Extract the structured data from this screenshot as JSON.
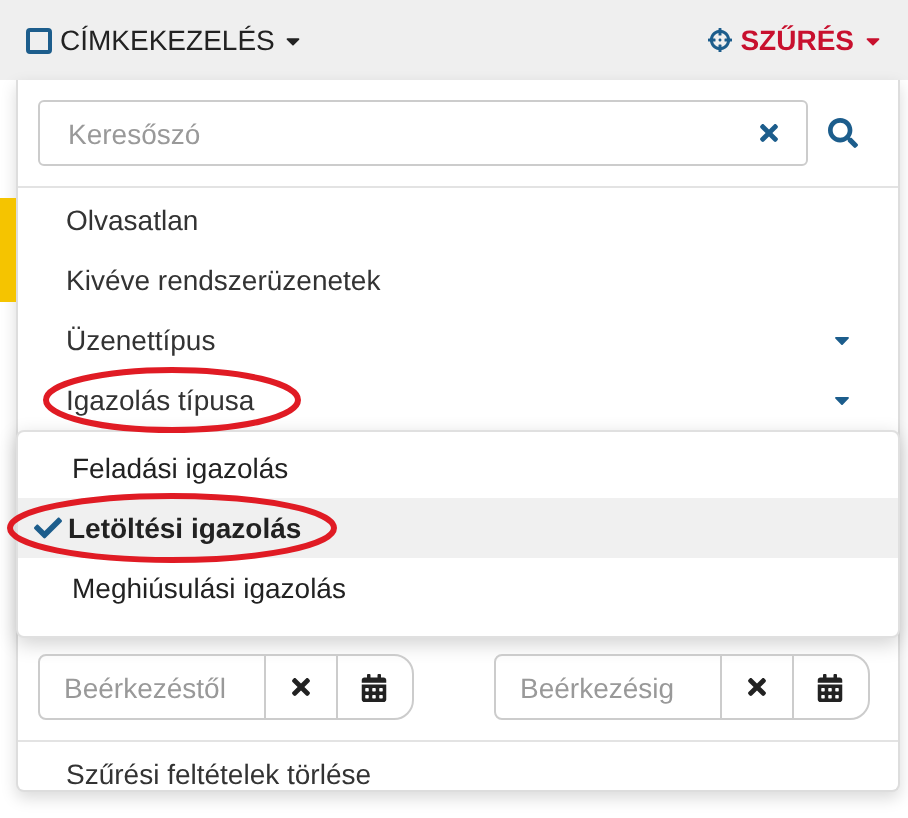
{
  "toolbar": {
    "labels_menu": "CÍMKEKEZELÉS",
    "filter_menu": "SZŰRÉS"
  },
  "filter_panel": {
    "search": {
      "placeholder": "Keresőszó"
    },
    "items": [
      {
        "label": "Olvasatlan",
        "kind": "plain",
        "highlighted": false
      },
      {
        "label": "Kivéve rendszerüzenetek",
        "kind": "plain",
        "highlighted": false
      },
      {
        "label": "Üzenettípus",
        "kind": "dropdown",
        "highlighted": false
      },
      {
        "label": "Igazolás típusa",
        "kind": "dropdown",
        "highlighted": true,
        "options": [
          {
            "label": "Feladási igazolás",
            "selected": false,
            "highlighted": false
          },
          {
            "label": "Letöltési igazolás",
            "selected": true,
            "highlighted": true
          },
          {
            "label": "Meghiúsulási igazolás",
            "selected": false,
            "highlighted": false
          }
        ]
      }
    ],
    "date_from": {
      "placeholder": "Beérkezéstől"
    },
    "date_to": {
      "placeholder": "Beérkezésig"
    },
    "clear": "Szűrési feltételek törlése"
  }
}
